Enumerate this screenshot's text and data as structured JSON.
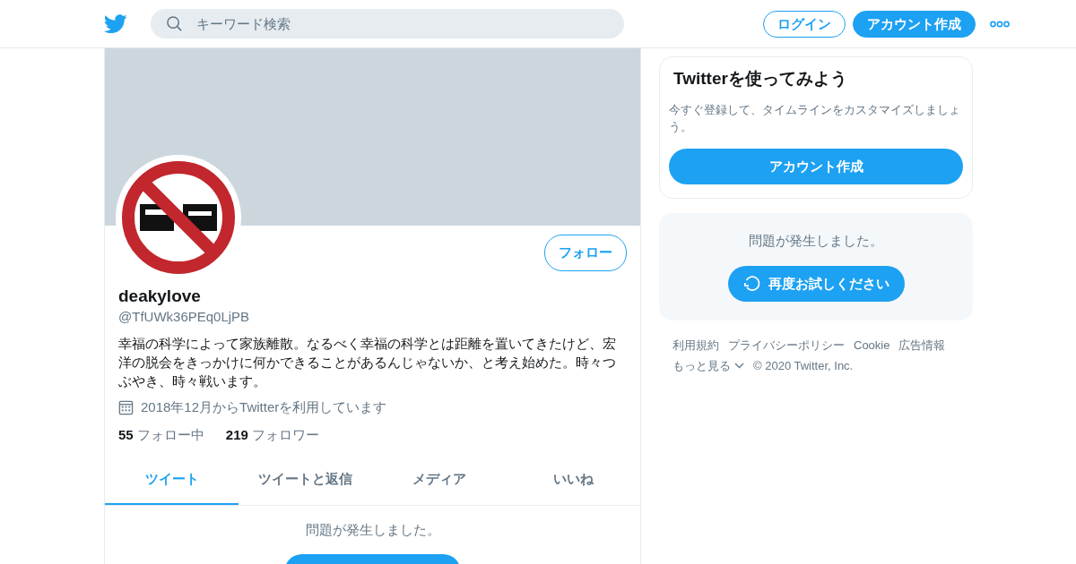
{
  "header": {
    "search": {
      "placeholder": "キーワード検索"
    },
    "buttons": [
      {
        "label": "ログイン",
        "kind": "outline"
      },
      {
        "label": "アカウント作成",
        "kind": "filled"
      }
    ]
  },
  "profile": {
    "follow_button": "フォロー",
    "name": "deakylove",
    "handle": "@TfUWk36PEq0LjPB",
    "bio": "幸福の科学によって家族離散。なるべく幸福の科学とは距離を置いてきたけど、宏洋の脱会をきっかけに何かできることがあるんじゃないか、と考え始めた。時々つぶやき、時々戦います。",
    "joined": "2018年12月からTwitterを利用しています",
    "stats": [
      {
        "count": "55",
        "label": "フォロー中"
      },
      {
        "count": "219",
        "label": "フォロワー"
      }
    ]
  },
  "tabs": [
    {
      "label": "ツイート",
      "selected": true
    },
    {
      "label": "ツイートと返信",
      "selected": false
    },
    {
      "label": "メディア",
      "selected": false
    },
    {
      "label": "いいね",
      "selected": false
    }
  ],
  "timeline": {
    "error": "問題が発生しました。"
  },
  "sidebar": {
    "signup_card": {
      "title": "Twitterを使ってみよう",
      "description": "今すぐ登録して、タイムラインをカスタマイズしましょう。",
      "button": "アカウント作成"
    },
    "error_card": {
      "message": "問題が発生しました。",
      "retry_button": "再度お試しください"
    },
    "footer": {
      "links": [
        "利用規約",
        "プライバシーポリシー",
        "Cookie",
        "広告情報"
      ],
      "more_link": "もっと見る",
      "copyright": "© 2020 Twitter, Inc."
    }
  }
}
